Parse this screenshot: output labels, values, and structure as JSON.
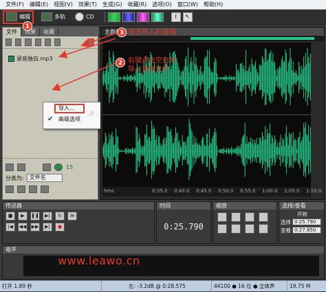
{
  "menubar": {
    "items": [
      "文件(F)",
      "编辑(E)",
      "视图(V)",
      "效果(T)",
      "生成(G)",
      "收藏(R)",
      "选项(O)",
      "窗口(W)",
      "帮助(H)"
    ]
  },
  "toolbar": {
    "edit": "编辑",
    "multitrack": "多轨",
    "cd": "CD"
  },
  "filepanel": {
    "tabs": [
      "文件",
      "效果",
      "收藏"
    ],
    "file_name": "录音独白.mp3",
    "sort_label": "分类为:",
    "sort_value": "文件名",
    "counter": "15"
  },
  "context_menu": {
    "import": "导入...",
    "advanced": "高级选项"
  },
  "main": {
    "tab": "主群组",
    "ruler": {
      "hms": "hms",
      "ticks": [
        "0:35.0",
        "0:40.0",
        "0:45.0",
        "0:50.0",
        "0:55.0",
        "1:00.0",
        "1:05.0",
        "1:10.0"
      ]
    }
  },
  "transport": {
    "title": "传送器"
  },
  "time": {
    "title": "时间",
    "value": "0:25.790"
  },
  "zoom": {
    "title": "缩放"
  },
  "selview": {
    "title": "选择/查看",
    "start_label": "开始",
    "select_label": "选择",
    "select_value": "0:25.790",
    "view_label": "查看",
    "view_value": "0:27.850"
  },
  "levels": {
    "title": "电平"
  },
  "watermark": "www.leawo.cn",
  "annotations": {
    "step1": "1",
    "step2": "2",
    "step3": "3",
    "text2_line1": "右键点击空白处,",
    "text2_line2": "导入音频文件",
    "text3": "双击导入的音频"
  },
  "status": {
    "left": "打开 1.89 秒",
    "level": "左: -3.2dB @ 0:28.575",
    "format": "44100 ● 16 位 ● 立体声",
    "size": "19.75 M"
  },
  "colors": {
    "waveform": "#27c98b",
    "accent": "#e23b2c"
  }
}
